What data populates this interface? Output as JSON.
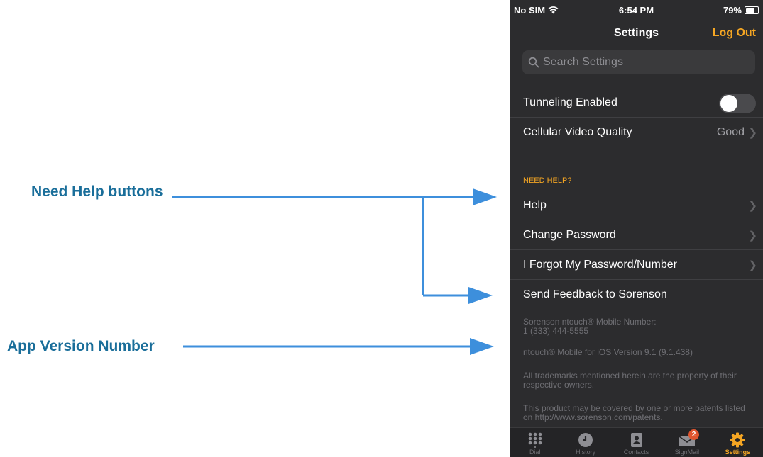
{
  "annotations": {
    "need_help": "Need Help buttons",
    "app_version": "App Version Number",
    "line_color": "#3d8fdc"
  },
  "status_bar": {
    "carrier": "No SIM",
    "time": "6:54 PM",
    "battery": "79%",
    "battery_level": 0.79
  },
  "nav": {
    "title": "Settings",
    "action": "Log Out"
  },
  "search": {
    "placeholder": "Search Settings"
  },
  "network_section": {
    "tunneling_label": "Tunneling Enabled",
    "tunneling_on": false,
    "video_quality_label": "Cellular Video Quality",
    "video_quality_value": "Good"
  },
  "help_section": {
    "header": "NEED HELP?",
    "items": [
      {
        "label": "Help"
      },
      {
        "label": "Change Password"
      },
      {
        "label": "I Forgot My Password/Number"
      },
      {
        "label": "Send Feedback to Sorenson"
      }
    ]
  },
  "footer": {
    "number_label": "Sorenson ntouch® Mobile Number:",
    "number_value": "1 (333) 444-5555",
    "version": "ntouch® Mobile for iOS Version 9.1 (9.1.438)",
    "trademarks": "All trademarks mentioned herein are the property of their respective owners.",
    "patents": "This product may be covered by one or more patents listed on http://www.sorenson.com/patents."
  },
  "tabs": [
    {
      "label": "Dial",
      "icon": "dial-pad-icon"
    },
    {
      "label": "History",
      "icon": "clock-icon"
    },
    {
      "label": "Contacts",
      "icon": "contacts-book-icon"
    },
    {
      "label": "SignMail",
      "icon": "envelope-icon",
      "badge": "2"
    },
    {
      "label": "Settings",
      "icon": "gear-icon",
      "active": true
    }
  ],
  "colors": {
    "accent": "#f5a623",
    "background": "#2c2c2e",
    "callout_text": "#1a6e9a"
  }
}
